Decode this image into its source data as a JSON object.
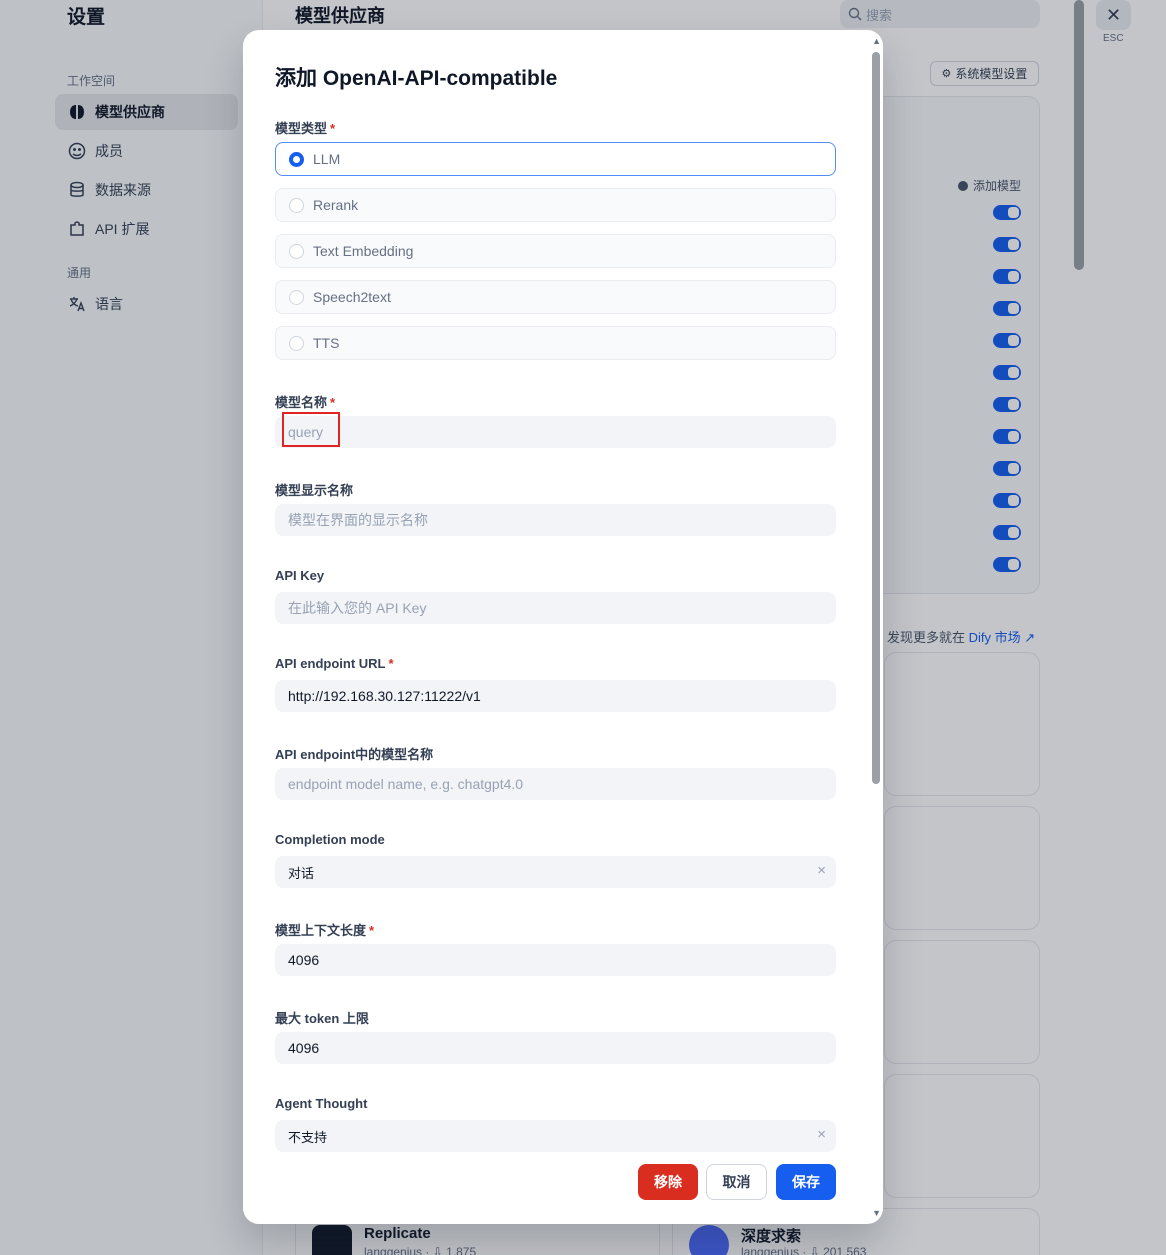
{
  "sidebar": {
    "title": "设置",
    "workspace_label": "工作空间",
    "general_label": "通用",
    "items": [
      {
        "label": "模型供应商"
      },
      {
        "label": "成员"
      },
      {
        "label": "数据来源"
      },
      {
        "label": "API 扩展"
      },
      {
        "label": "语言"
      }
    ]
  },
  "header": {
    "title": "模型供应商",
    "search_placeholder": "搜索",
    "close_label": "ESC",
    "system_model_settings": "系统模型设置"
  },
  "background": {
    "add_model": "添加模型",
    "discover_prefix": "发现更多就在",
    "discover_link": "Dify 市场",
    "bottom_cards": [
      {
        "name": "Replicate",
        "meta": "langgenius · ⇩ 1,875"
      },
      {
        "name": "深度求索",
        "meta": "langgenius · ⇩ 201,563"
      }
    ]
  },
  "modal": {
    "title": "添加 OpenAI-API-compatible",
    "model_type": {
      "label": "模型类型",
      "options": [
        "LLM",
        "Rerank",
        "Text Embedding",
        "Speech2text",
        "TTS"
      ],
      "selected": "LLM"
    },
    "model_name": {
      "label": "模型名称",
      "value": "",
      "placeholder": "query"
    },
    "display_name": {
      "label": "模型显示名称",
      "placeholder": "模型在界面的显示名称"
    },
    "api_key": {
      "label": "API Key",
      "placeholder": "在此输入您的 API Key"
    },
    "endpoint_url": {
      "label": "API endpoint URL",
      "value": "http://192.168.30.127:11222/v1"
    },
    "endpoint_model_name": {
      "label": "API endpoint中的模型名称",
      "placeholder": "endpoint model name, e.g. chatgpt4.0"
    },
    "completion_mode": {
      "label": "Completion mode",
      "value": "对话"
    },
    "context_length": {
      "label": "模型上下文长度",
      "value": "4096"
    },
    "max_tokens": {
      "label": "最大 token 上限",
      "value": "4096"
    },
    "agent_thought": {
      "label": "Agent Thought",
      "value": "不支持"
    },
    "buttons": {
      "remove": "移除",
      "cancel": "取消",
      "save": "保存"
    }
  }
}
